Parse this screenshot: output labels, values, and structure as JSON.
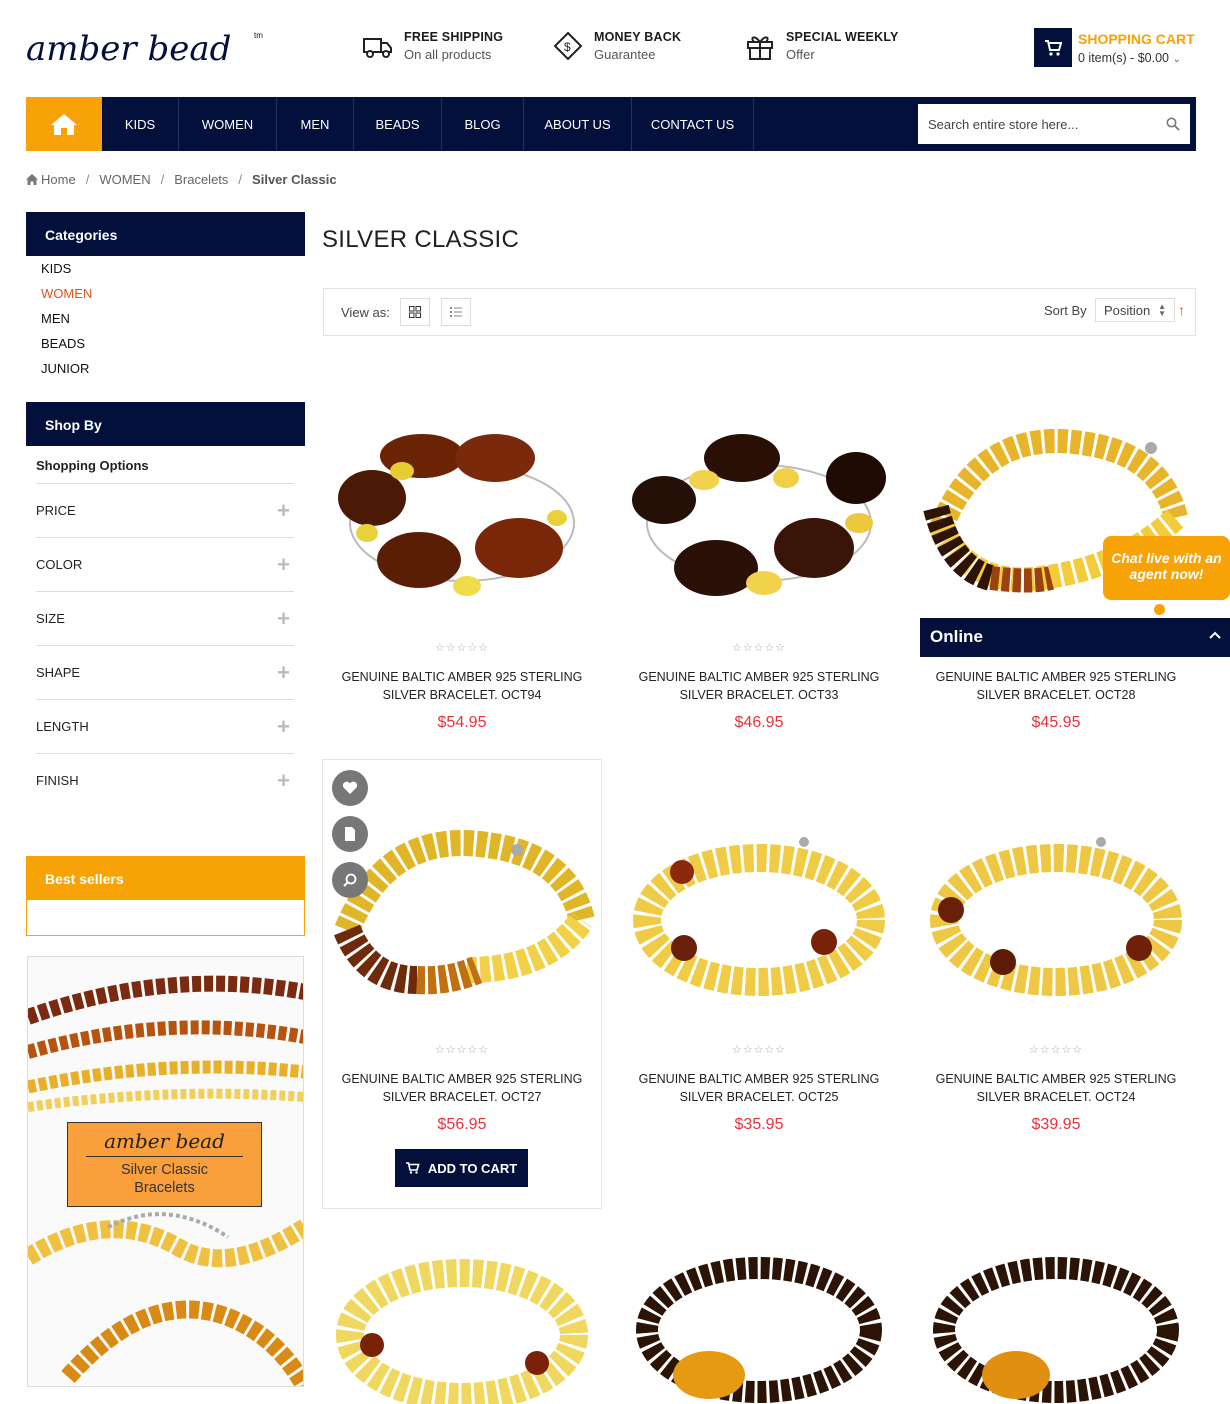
{
  "brand": {
    "logo_text": "amber bead",
    "tm": "tm"
  },
  "features": [
    {
      "title": "FREE SHIPPING",
      "sub": "On all products",
      "icon": "truck-icon"
    },
    {
      "title": "MONEY BACK",
      "sub": "Guarantee",
      "icon": "money-tag-icon"
    },
    {
      "title": "SPECIAL WEEKLY",
      "sub": "Offer",
      "icon": "gift-icon"
    }
  ],
  "cart": {
    "title": "SHOPPING CART",
    "summary": "0 item(s) - $0.00"
  },
  "nav": {
    "items": [
      "KIDS",
      "WOMEN",
      "MEN",
      "BEADS",
      "BLOG",
      "ABOUT US",
      "CONTACT US"
    ],
    "search_placeholder": "Search entire store here..."
  },
  "breadcrumb": {
    "home": "Home",
    "level1": "WOMEN",
    "level2": "Bracelets",
    "current": "Silver Classic"
  },
  "sidebar": {
    "categories_title": "Categories",
    "categories": [
      "KIDS",
      "WOMEN",
      "MEN",
      "BEADS",
      "JUNIOR"
    ],
    "active_category": "WOMEN",
    "shopby_title": "Shop By",
    "shopping_options": "Shopping Options",
    "filters": [
      "PRICE",
      "COLOR",
      "SIZE",
      "SHAPE",
      "LENGTH",
      "FINISH"
    ],
    "bestsellers_title": "Best sellers",
    "promo": {
      "logo": "amber bead",
      "line1": "Silver Classic",
      "line2": "Bracelets"
    }
  },
  "main": {
    "title": "SILVER CLASSIC",
    "view_as": "View as:",
    "sort_by": "Sort By",
    "sort_value": "Position",
    "add_to_cart": "ADD TO CART"
  },
  "products": [
    {
      "line1": "GENUINE BALTIC AMBER 925 STERLING",
      "line2": "SILVER BRACELET. OCT94",
      "price": "$54.95"
    },
    {
      "line1": "GENUINE BALTIC AMBER 925 STERLING",
      "line2": "SILVER BRACELET. OCT33",
      "price": "$46.95"
    },
    {
      "line1": "GENUINE BALTIC AMBER 925 STERLING",
      "line2": "SILVER BRACELET. OCT28",
      "price": "$45.95"
    },
    {
      "line1": "GENUINE BALTIC AMBER 925 STERLING",
      "line2": "SILVER BRACELET. OCT27",
      "price": "$56.95"
    },
    {
      "line1": "GENUINE BALTIC AMBER 925 STERLING",
      "line2": "SILVER BRACELET. OCT25",
      "price": "$35.95"
    },
    {
      "line1": "GENUINE BALTIC AMBER 925 STERLING",
      "line2": "SILVER BRACELET. OCT24",
      "price": "$39.95"
    }
  ],
  "chat": {
    "bubble": "Chat live with an agent now!",
    "status": "Online"
  },
  "colors": {
    "navy": "#03103b",
    "orange": "#f7a307",
    "price_red": "#e8333a",
    "active_link": "#e0541c"
  }
}
